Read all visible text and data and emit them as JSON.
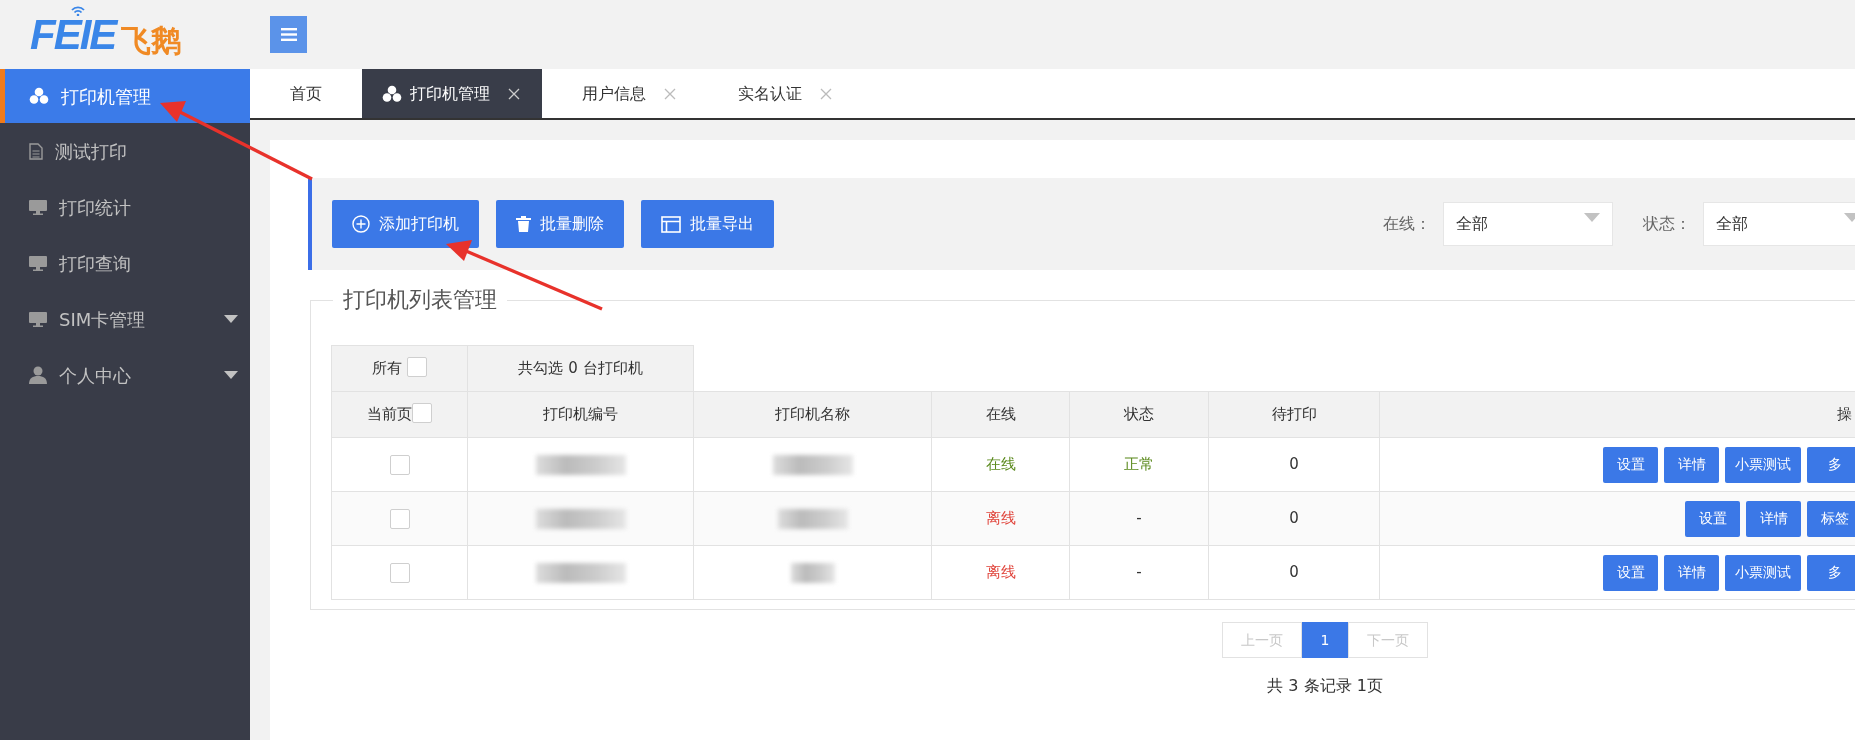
{
  "logo": {
    "latin": "FEIE",
    "chinese": "飞鹅"
  },
  "sidebar": {
    "items": [
      {
        "label": "打印机管理",
        "kind": "cubes",
        "selected": true,
        "expandable": false
      },
      {
        "label": "测试打印",
        "kind": "file",
        "selected": false,
        "expandable": false
      },
      {
        "label": "打印统计",
        "kind": "monitor",
        "selected": false,
        "expandable": false
      },
      {
        "label": "打印查询",
        "kind": "monitor",
        "selected": false,
        "expandable": false
      },
      {
        "label": "SIM卡管理",
        "kind": "monitor",
        "selected": false,
        "expandable": true
      },
      {
        "label": "个人中心",
        "kind": "user",
        "selected": false,
        "expandable": true
      }
    ]
  },
  "tabs": [
    {
      "label": "首页",
      "selected": false,
      "closable": false
    },
    {
      "label": "打印机管理",
      "selected": true,
      "closable": true,
      "kind": "cubes"
    },
    {
      "label": "用户信息",
      "selected": false,
      "closable": true
    },
    {
      "label": "实名认证",
      "selected": false,
      "closable": true
    }
  ],
  "toolbar": {
    "buttons": [
      {
        "label": "添加打印机",
        "kind": "plus-circle"
      },
      {
        "label": "批量删除",
        "kind": "trash"
      },
      {
        "label": "批量导出",
        "kind": "window"
      }
    ],
    "filters": [
      {
        "label": "在线：",
        "value": "全部"
      },
      {
        "label": "状态：",
        "value": "全部"
      }
    ]
  },
  "panel": {
    "legend": "打印机列表管理"
  },
  "table": {
    "select_all": {
      "label": "所有",
      "checked": false
    },
    "selection_count": "共勾选 0 台打印机",
    "select_page": {
      "label": "当前页",
      "checked": false
    },
    "columns": [
      "打印机编号",
      "打印机名称",
      "在线",
      "状态",
      "待打印",
      "操"
    ],
    "rows": [
      {
        "checked": false,
        "online": true,
        "online_text": "在线",
        "status": "正常",
        "pending": "0",
        "actions": [
          "设置",
          "详情",
          "小票测试",
          "多"
        ]
      },
      {
        "checked": false,
        "online": false,
        "online_text": "离线",
        "status": "-",
        "pending": "0",
        "actions": [
          "设置",
          "详情",
          "标签"
        ]
      },
      {
        "checked": false,
        "online": false,
        "online_text": "离线",
        "status": "-",
        "pending": "0",
        "actions": [
          "设置",
          "详情",
          "小票测试",
          "多"
        ]
      }
    ]
  },
  "pagination": {
    "items": [
      {
        "label": "上一页",
        "disabled": true,
        "selected": false
      },
      {
        "label": "1",
        "disabled": false,
        "selected": true
      },
      {
        "label": "下一页",
        "disabled": true,
        "selected": false
      }
    ],
    "summary": "共 3 条记录 1页"
  }
}
